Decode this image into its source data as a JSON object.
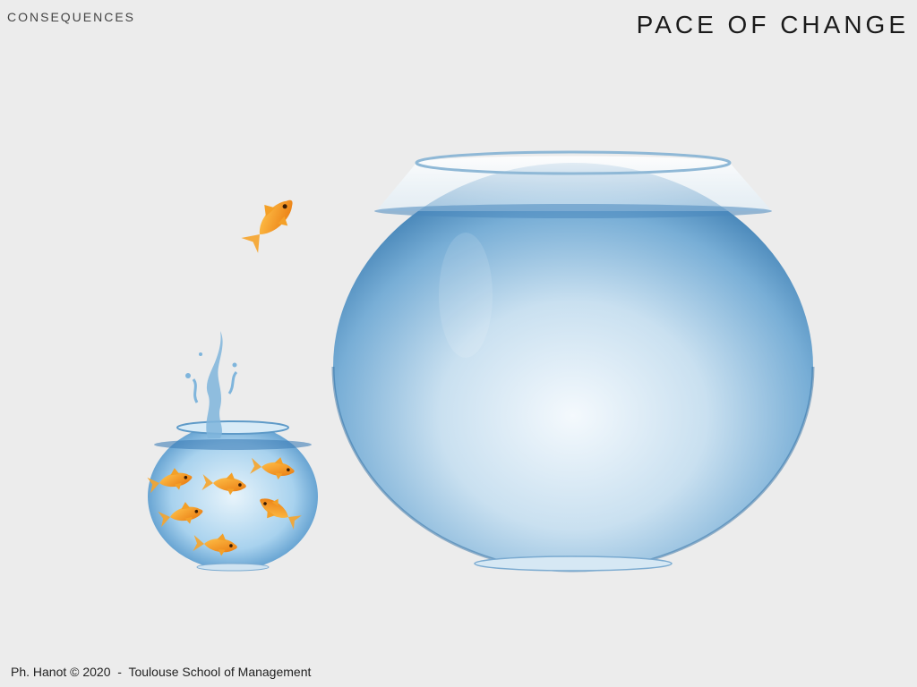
{
  "header": {
    "section": "CONSEQUENCES",
    "title": "PACE OF CHANGE"
  },
  "footer": {
    "credit": "Ph. Hanot © 2020  -  Toulouse School of Management"
  },
  "illustration": {
    "small_bowl_fish_count": 6,
    "colors": {
      "background": "#ececec",
      "water": "#5b95c4",
      "fish": "#f29b1e"
    }
  }
}
